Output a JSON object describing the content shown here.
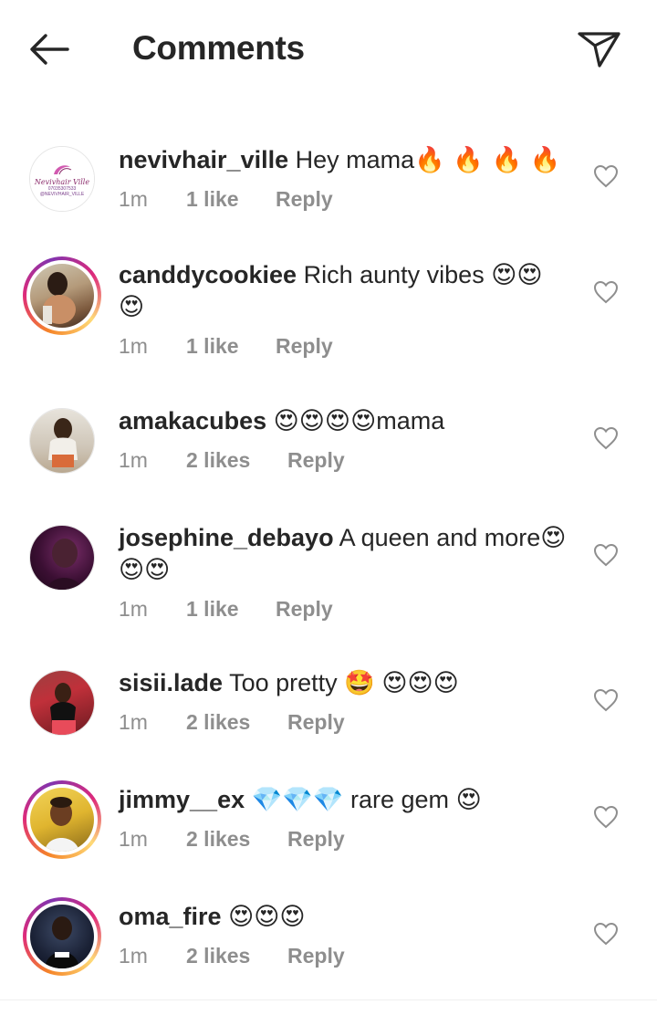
{
  "header": {
    "title": "Comments",
    "back_icon": "arrow-left-icon",
    "send_icon": "paper-plane-icon"
  },
  "colors": {
    "text": "#262626",
    "meta": "#8e8e8e",
    "story_ring": [
      "#f58529",
      "#dd2a7b",
      "#8134af",
      "#feda77"
    ]
  },
  "avatar_logo": {
    "script": "Nevivhair Ville",
    "phone": "07035307533",
    "handle": "@NEVIVHAIR_VILLE"
  },
  "comments": [
    {
      "username": "nevivhair_ville",
      "text": "Hey mama",
      "emoji": "🔥 🔥 🔥 🔥",
      "time": "1m",
      "likes": "1 like",
      "reply": "Reply"
    },
    {
      "username": "canddycookiee",
      "text": "Rich aunty vibes",
      "emoji": "😍😍",
      "emoji2": "😍",
      "time": "1m",
      "likes": "1 like",
      "reply": "Reply"
    },
    {
      "username": "amakacubes",
      "text": "mama",
      "emoji": "😍😍😍😍",
      "time": "1m",
      "likes": "2 likes",
      "reply": "Reply"
    },
    {
      "username": "josephine_debayo",
      "text": "A queen and more",
      "emoji": "😍",
      "emoji2": "😍😍",
      "time": "1m",
      "likes": "1 like",
      "reply": "Reply"
    },
    {
      "username": "sisii.lade",
      "text": "Too pretty",
      "emoji": "🤩",
      "emoji_b": "😍😍😍",
      "time": "1m",
      "likes": "2 likes",
      "reply": "Reply"
    },
    {
      "username": "jimmy__ex",
      "text": "rare gem",
      "emoji": "💎💎💎",
      "emoji_b": "😍",
      "time": "1m",
      "likes": "2 likes",
      "reply": "Reply"
    },
    {
      "username": "oma_fire",
      "text": "",
      "emoji": "😍😍😍",
      "time": "1m",
      "likes": "2 likes",
      "reply": "Reply"
    }
  ]
}
